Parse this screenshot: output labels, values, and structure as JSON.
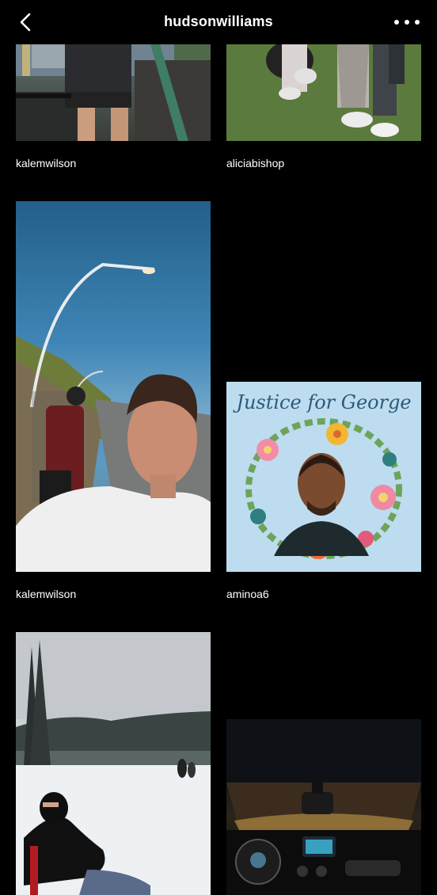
{
  "header": {
    "title": "hudsonwilliams",
    "back_icon": "chevron-left-icon",
    "more_icon": "more-horizontal-icon"
  },
  "posts": [
    {
      "username": "kalemwilson"
    },
    {
      "username": "aliciabishop"
    },
    {
      "username": "kalemwilson"
    },
    {
      "username": "aminoa6",
      "image_text": "Justice for George"
    },
    {
      "username": ""
    },
    {
      "username": ""
    }
  ]
}
